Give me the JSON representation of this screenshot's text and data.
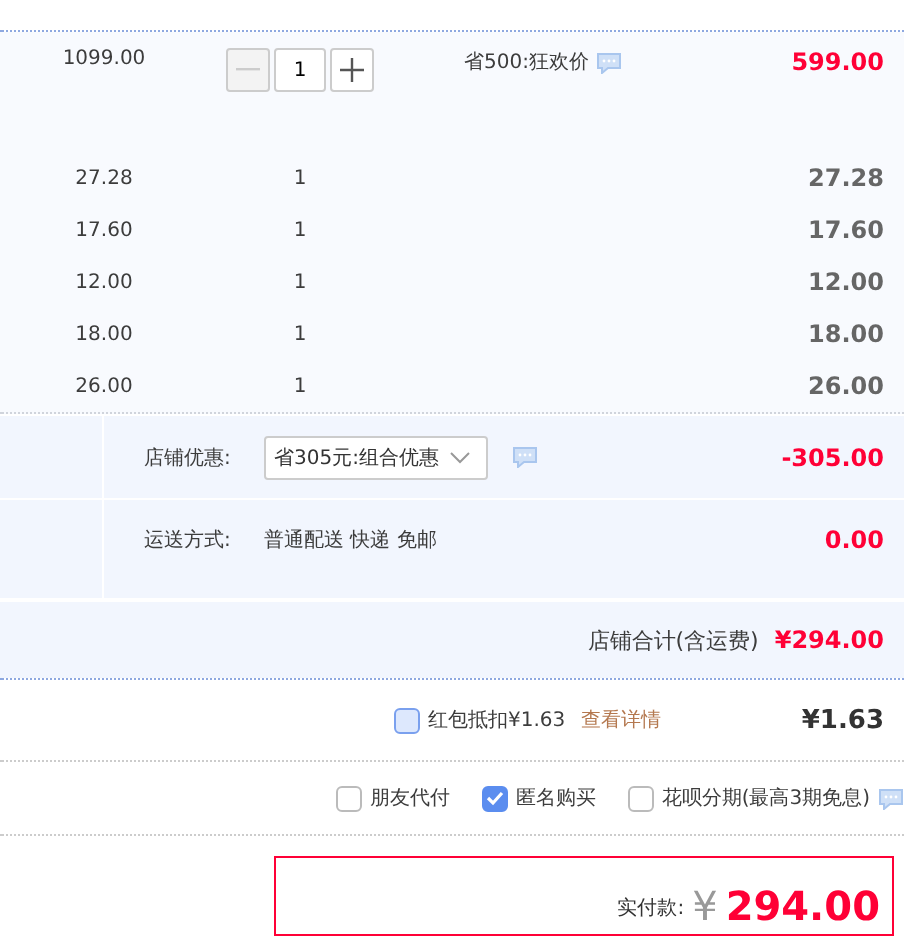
{
  "main_item": {
    "unit_price": "1099.00",
    "quantity": "1",
    "decrease_disabled": true,
    "promo": "省500:狂欢价",
    "total": "599.00"
  },
  "items": [
    {
      "price": "27.28",
      "quantity": "1",
      "total": "27.28"
    },
    {
      "price": "17.60",
      "quantity": "1",
      "total": "17.60"
    },
    {
      "price": "12.00",
      "quantity": "1",
      "total": "12.00"
    },
    {
      "price": "18.00",
      "quantity": "1",
      "total": "18.00"
    },
    {
      "price": "26.00",
      "quantity": "1",
      "total": "26.00"
    }
  ],
  "shop": {
    "discount_label": "店铺优惠:",
    "discount_select": "省305元:组合优惠",
    "discount_amount": "-305.00",
    "shipping_label": "运送方式:",
    "shipping_value": "普通配送 快递 免邮",
    "shipping_amount": "0.00",
    "total_label": "店铺合计(含运费)",
    "total_value": "¥294.00"
  },
  "red_packet": {
    "label": "红包抵扣¥1.63",
    "checked": false,
    "link": "查看详情",
    "amount": "¥1.63"
  },
  "options": [
    {
      "label": "朋友代付",
      "checked": false,
      "info": false
    },
    {
      "label": "匿名购买",
      "checked": true,
      "info": false
    },
    {
      "label": "花呗分期(最高3期免息)",
      "checked": false,
      "info": true
    }
  ],
  "pay": {
    "label": "实付款:",
    "currency": "¥",
    "amount": "294.00"
  }
}
